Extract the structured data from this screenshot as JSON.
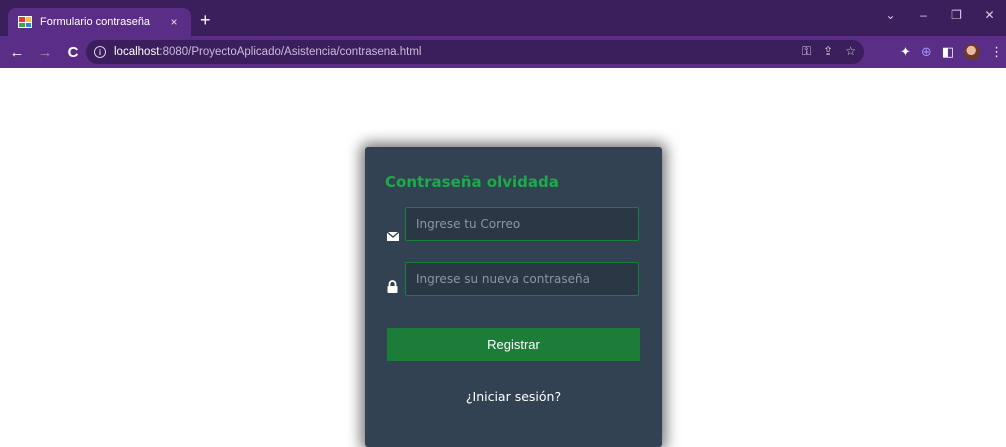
{
  "browser": {
    "tab": {
      "title": "Formulario contraseña",
      "close": "×"
    },
    "new_tab": "+",
    "window_controls": [
      "⌄",
      "–",
      "❐",
      "✕"
    ],
    "nav": {
      "back": "←",
      "forward": "→",
      "reload": "C"
    },
    "address": {
      "host": "localhost",
      "path": ":8080/ProyectoAplicado/Asistencia/contrasena.html"
    }
  },
  "form": {
    "title": "Contraseña olvidada",
    "email_placeholder": "Ingrese tu Correo",
    "password_placeholder": "Ingrese su nueva contraseña",
    "register_label": "Registrar",
    "login_link": "¿Iniciar sesión?"
  },
  "colors": {
    "accent_green": "#1bab4a",
    "card_bg": "#334252",
    "browser_purple": "#5a2d86"
  }
}
